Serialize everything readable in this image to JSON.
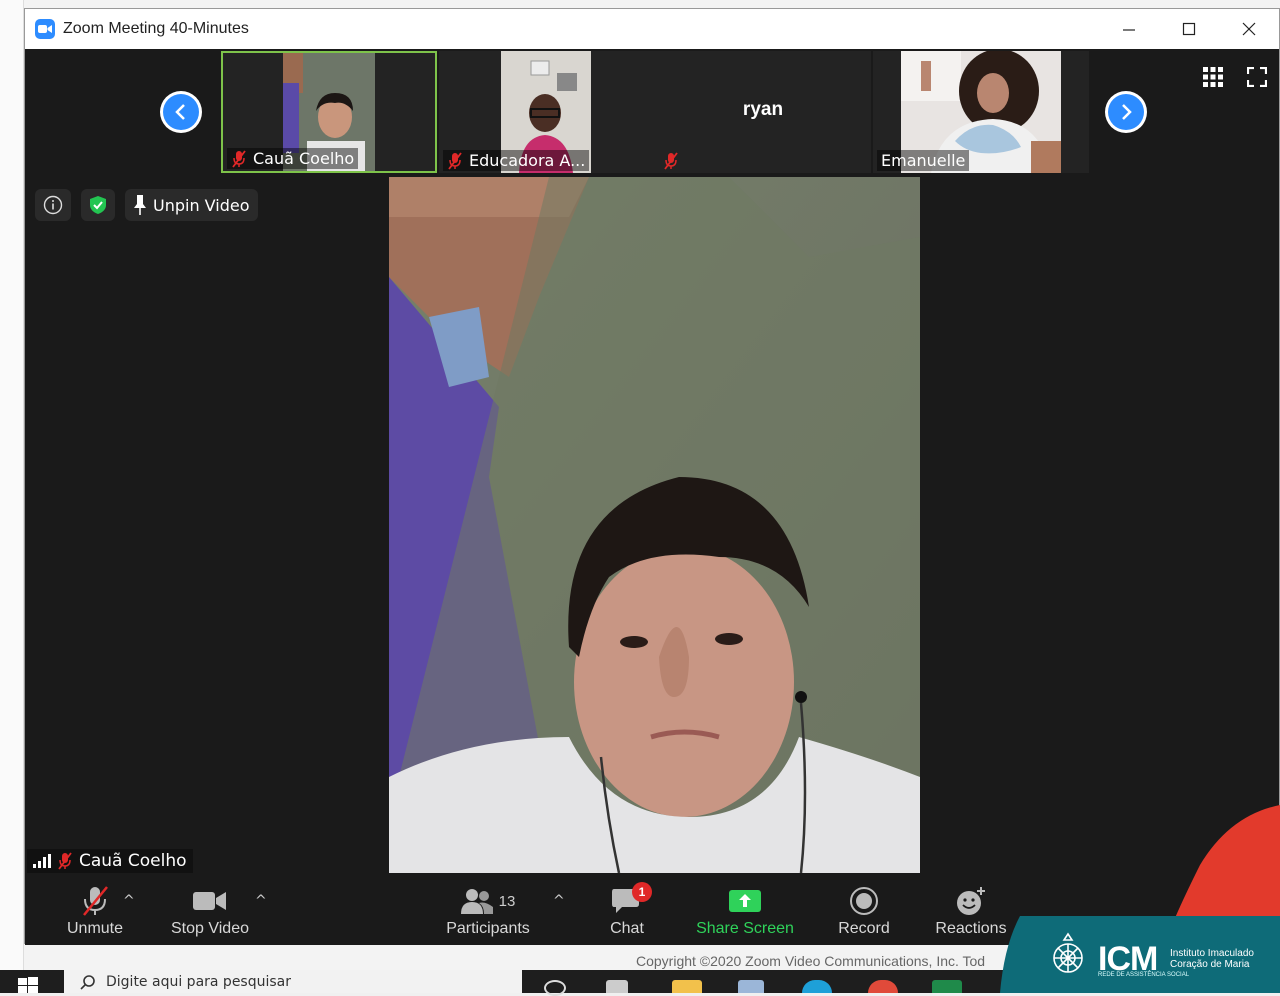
{
  "window": {
    "title": "Zoom Meeting 40-Minutes"
  },
  "thumbnails": [
    {
      "name": "Cauã Coelho",
      "muted": true,
      "active": true
    },
    {
      "name": "Educadora A...",
      "muted": true,
      "active": false
    },
    {
      "name": "ryan",
      "muted": true,
      "active": false,
      "center_name": "ryan"
    },
    {
      "name": "Emanuelle",
      "muted": false,
      "active": false
    }
  ],
  "info_bar": {
    "unpin_label": "Unpin Video"
  },
  "speaker": {
    "name": "Cauã Coelho"
  },
  "toolbar": {
    "unmute_label": "Unmute",
    "stop_video_label": "Stop Video",
    "participants_label": "Participants",
    "participants_count": "13",
    "chat_label": "Chat",
    "chat_badge": "1",
    "share_label": "Share Screen",
    "record_label": "Record",
    "reactions_label": "Reactions"
  },
  "copyright": "Copyright ©2020 Zoom Video Communications, Inc. Tod",
  "taskbar": {
    "search_placeholder": "Digite aqui para pesquisar"
  },
  "logo": {
    "brand": "ICM",
    "line1": "Instituto Imaculado",
    "line2": "Coração de Maria",
    "tagline": "REDE DE ASSISTÊNCIA SOCIAL"
  },
  "colors": {
    "zoom_blue": "#2d8cff",
    "active_border": "#7ec34a",
    "share_green": "#2fd25a",
    "muted_red": "#e02828",
    "icm_teal": "#0e6b78",
    "icm_red": "#e23a2c"
  }
}
